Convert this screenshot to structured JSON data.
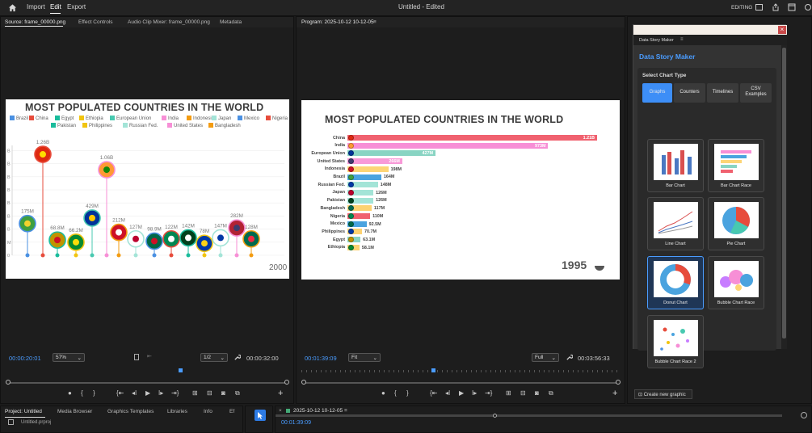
{
  "topbar": {
    "import": "Import",
    "edit": "Edit",
    "export": "Export",
    "title": "Untitled - Edited",
    "workspace": "EDITING"
  },
  "source": {
    "tabs": [
      "Source: frame_00000.png",
      "Effect Controls",
      "Audio Clip Mixer: frame_00000.png",
      "Metadata"
    ],
    "timecode": "00:00:20:01",
    "zoom": "57%",
    "ratio": "1/2",
    "duration": "00:00:32:00",
    "year": "2000"
  },
  "program": {
    "tab": "Program: 2025-10-12 10-12-05",
    "timecode": "00:01:39:09",
    "zoom": "Fit",
    "quality": "Full",
    "duration": "00:03:56:33",
    "year": "1995"
  },
  "chart_data": [
    {
      "type": "scatter",
      "title": "MOST POPULATED COUNTRIES IN THE WORLD",
      "legend": [
        "Brazil",
        "China",
        "Egypt",
        "Ethiopia",
        "European Union",
        "India",
        "Indonesia",
        "Japan",
        "Mexico",
        "Nigeria",
        "Pakistan",
        "Philippines",
        "Russian Fed.",
        "United States",
        "Bangladesh"
      ],
      "y_ticks": [
        "B",
        "B",
        "B",
        "B",
        "B",
        "B",
        "B",
        "M",
        "0"
      ],
      "points": [
        {
          "label": "175M",
          "color": "#4a90e2"
        },
        {
          "label": "1.26B",
          "color": "#e74c3c"
        },
        {
          "label": "68.8M",
          "color": "#1abc9c"
        },
        {
          "label": "66.2M",
          "color": "#f1c40f"
        },
        {
          "label": "429M",
          "color": "#48c9b0"
        },
        {
          "label": "1.06B",
          "color": "#f78fd6"
        },
        {
          "label": "212M",
          "color": "#f39c12"
        },
        {
          "label": "127M",
          "color": "#a3e4d7"
        },
        {
          "label": "98.9M",
          "color": "#4a90e2"
        },
        {
          "label": "122M",
          "color": "#e74c3c"
        },
        {
          "label": "142M",
          "color": "#1abc9c"
        },
        {
          "label": "78M",
          "color": "#f1c40f"
        },
        {
          "label": "147M",
          "color": "#a3e4d7"
        },
        {
          "label": "282M",
          "color": "#f78fd6"
        },
        {
          "label": "128M",
          "color": "#f39c12"
        }
      ]
    },
    {
      "type": "bar",
      "title": "MOST POPULATED COUNTRIES IN THE WORLD",
      "categories": [
        "China",
        "India",
        "European Union",
        "United States",
        "Indonesia",
        "Brazil",
        "Russian Fed.",
        "Japan",
        "Pakistan",
        "Bangladesh",
        "Nigeria",
        "Mexico",
        "Philippines",
        "Egypt",
        "Ethiopia"
      ],
      "values": [
        1210,
        973,
        427,
        266,
        198,
        164,
        148,
        126,
        126,
        117,
        110,
        92.5,
        70.7,
        63.1,
        58.1
      ],
      "labels": [
        "1.21B",
        "973M",
        "427M",
        "266M",
        "198M",
        "164M",
        "148M",
        "126M",
        "126M",
        "117M",
        "110M",
        "92.5M",
        "70.7M",
        "63.1M",
        "58.1M"
      ],
      "colors": [
        "#f0616f",
        "#f78fd6",
        "#89d4c3",
        "#f89ad8",
        "#fdd576",
        "#4aa3df",
        "#a3e4d7",
        "#a3e4d7",
        "#a3e4d7",
        "#fcd272",
        "#f0616f",
        "#4aa3df",
        "#fcd272",
        "#89d4c3",
        "#fcd272"
      ]
    }
  ],
  "dsm": {
    "panel_title": "Data Story Maker",
    "heading": "Data Story Maker",
    "select_label": "Select Chart Type",
    "tabs": [
      "Graphs",
      "Counters",
      "Timelines",
      "CSV Examples"
    ],
    "cards": [
      "Bar Chart",
      "Bar Chart Race",
      "Line Chart",
      "Pie Chart",
      "Donut Chart",
      "Bubble Chart Race",
      "Bubble Chart Race 2"
    ],
    "create": "Create new graphic",
    "close": "×"
  },
  "project": {
    "tabs": [
      "Project: Untitled",
      "Media Browser",
      "Graphics Templates",
      "Libraries",
      "Info",
      "Ef"
    ],
    "item": "Untitled.prproj"
  },
  "timeline": {
    "tab": "2025-10-12 10-12-05",
    "timecode": "00:01:39:09"
  },
  "colors": {
    "accent": "#4a9cff",
    "active_tab": "#3d8ef7"
  }
}
